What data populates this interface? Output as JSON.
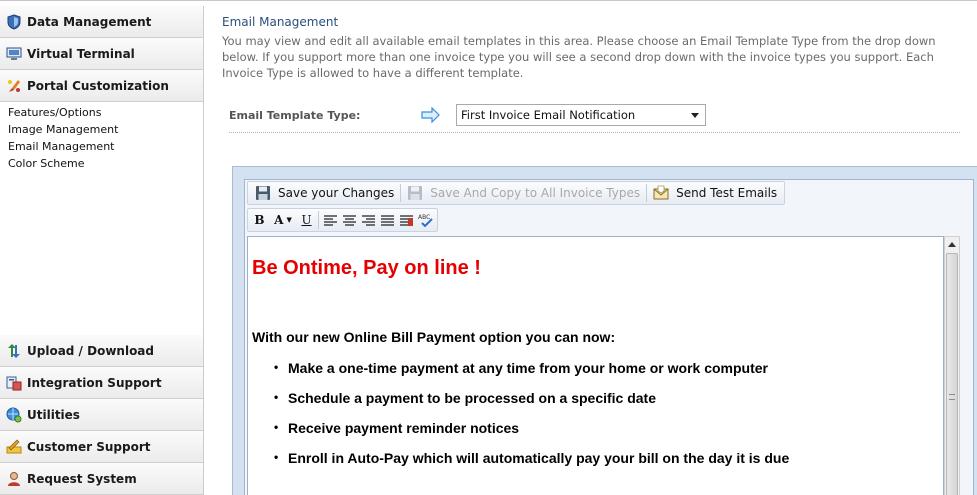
{
  "sidebar": {
    "top_sections": [
      {
        "label": "Data Management",
        "icon": "shield-icon"
      },
      {
        "label": "Virtual Terminal",
        "icon": "computer-icon"
      },
      {
        "label": "Portal Customization",
        "icon": "paint-brush-icon"
      }
    ],
    "sub_items": [
      "Features/Options",
      "Image Management",
      "Email Management",
      "Color Scheme"
    ],
    "bottom_sections": [
      {
        "label": "Upload / Download",
        "icon": "up-down-arrows-icon"
      },
      {
        "label": "Integration Support",
        "icon": "integration-icon"
      },
      {
        "label": "Utilities",
        "icon": "globe-gear-icon"
      },
      {
        "label": "Customer Support",
        "icon": "pencil-support-icon"
      },
      {
        "label": "Request System",
        "icon": "person-request-icon"
      }
    ]
  },
  "main": {
    "title": "Email Management",
    "description": "You may view and edit all available email templates in this area. Please choose an Email Template Type from the drop down below. If you support more than one invoice type you will see a second drop down with the invoice types you support. Each Invoice Type is allowed to have a different template.",
    "template_type_label": "Email Template Type:",
    "template_type_value": "First Invoice Email Notification"
  },
  "editor": {
    "toolbar": {
      "save_label": "Save your Changes",
      "save_copy_label": "Save And Copy to All Invoice Types",
      "send_test_label": "Send Test Emails",
      "bold_label": "B",
      "font_label": "A",
      "underline_label": "U"
    },
    "content": {
      "heading": "Be Ontime, Pay on line !",
      "intro": "With our new Online Bill Payment option you can now:",
      "items": [
        "Make a one-time payment at any time from your home or work computer",
        "Schedule a payment to be processed on a specific date",
        "Receive payment reminder notices",
        "Enroll in Auto-Pay which will automatically pay your bill on the day it is due"
      ]
    }
  },
  "colors": {
    "heading_red": "#e60000",
    "title_blue": "#2a4f7e",
    "editor_frame": "#d4e1f1"
  }
}
